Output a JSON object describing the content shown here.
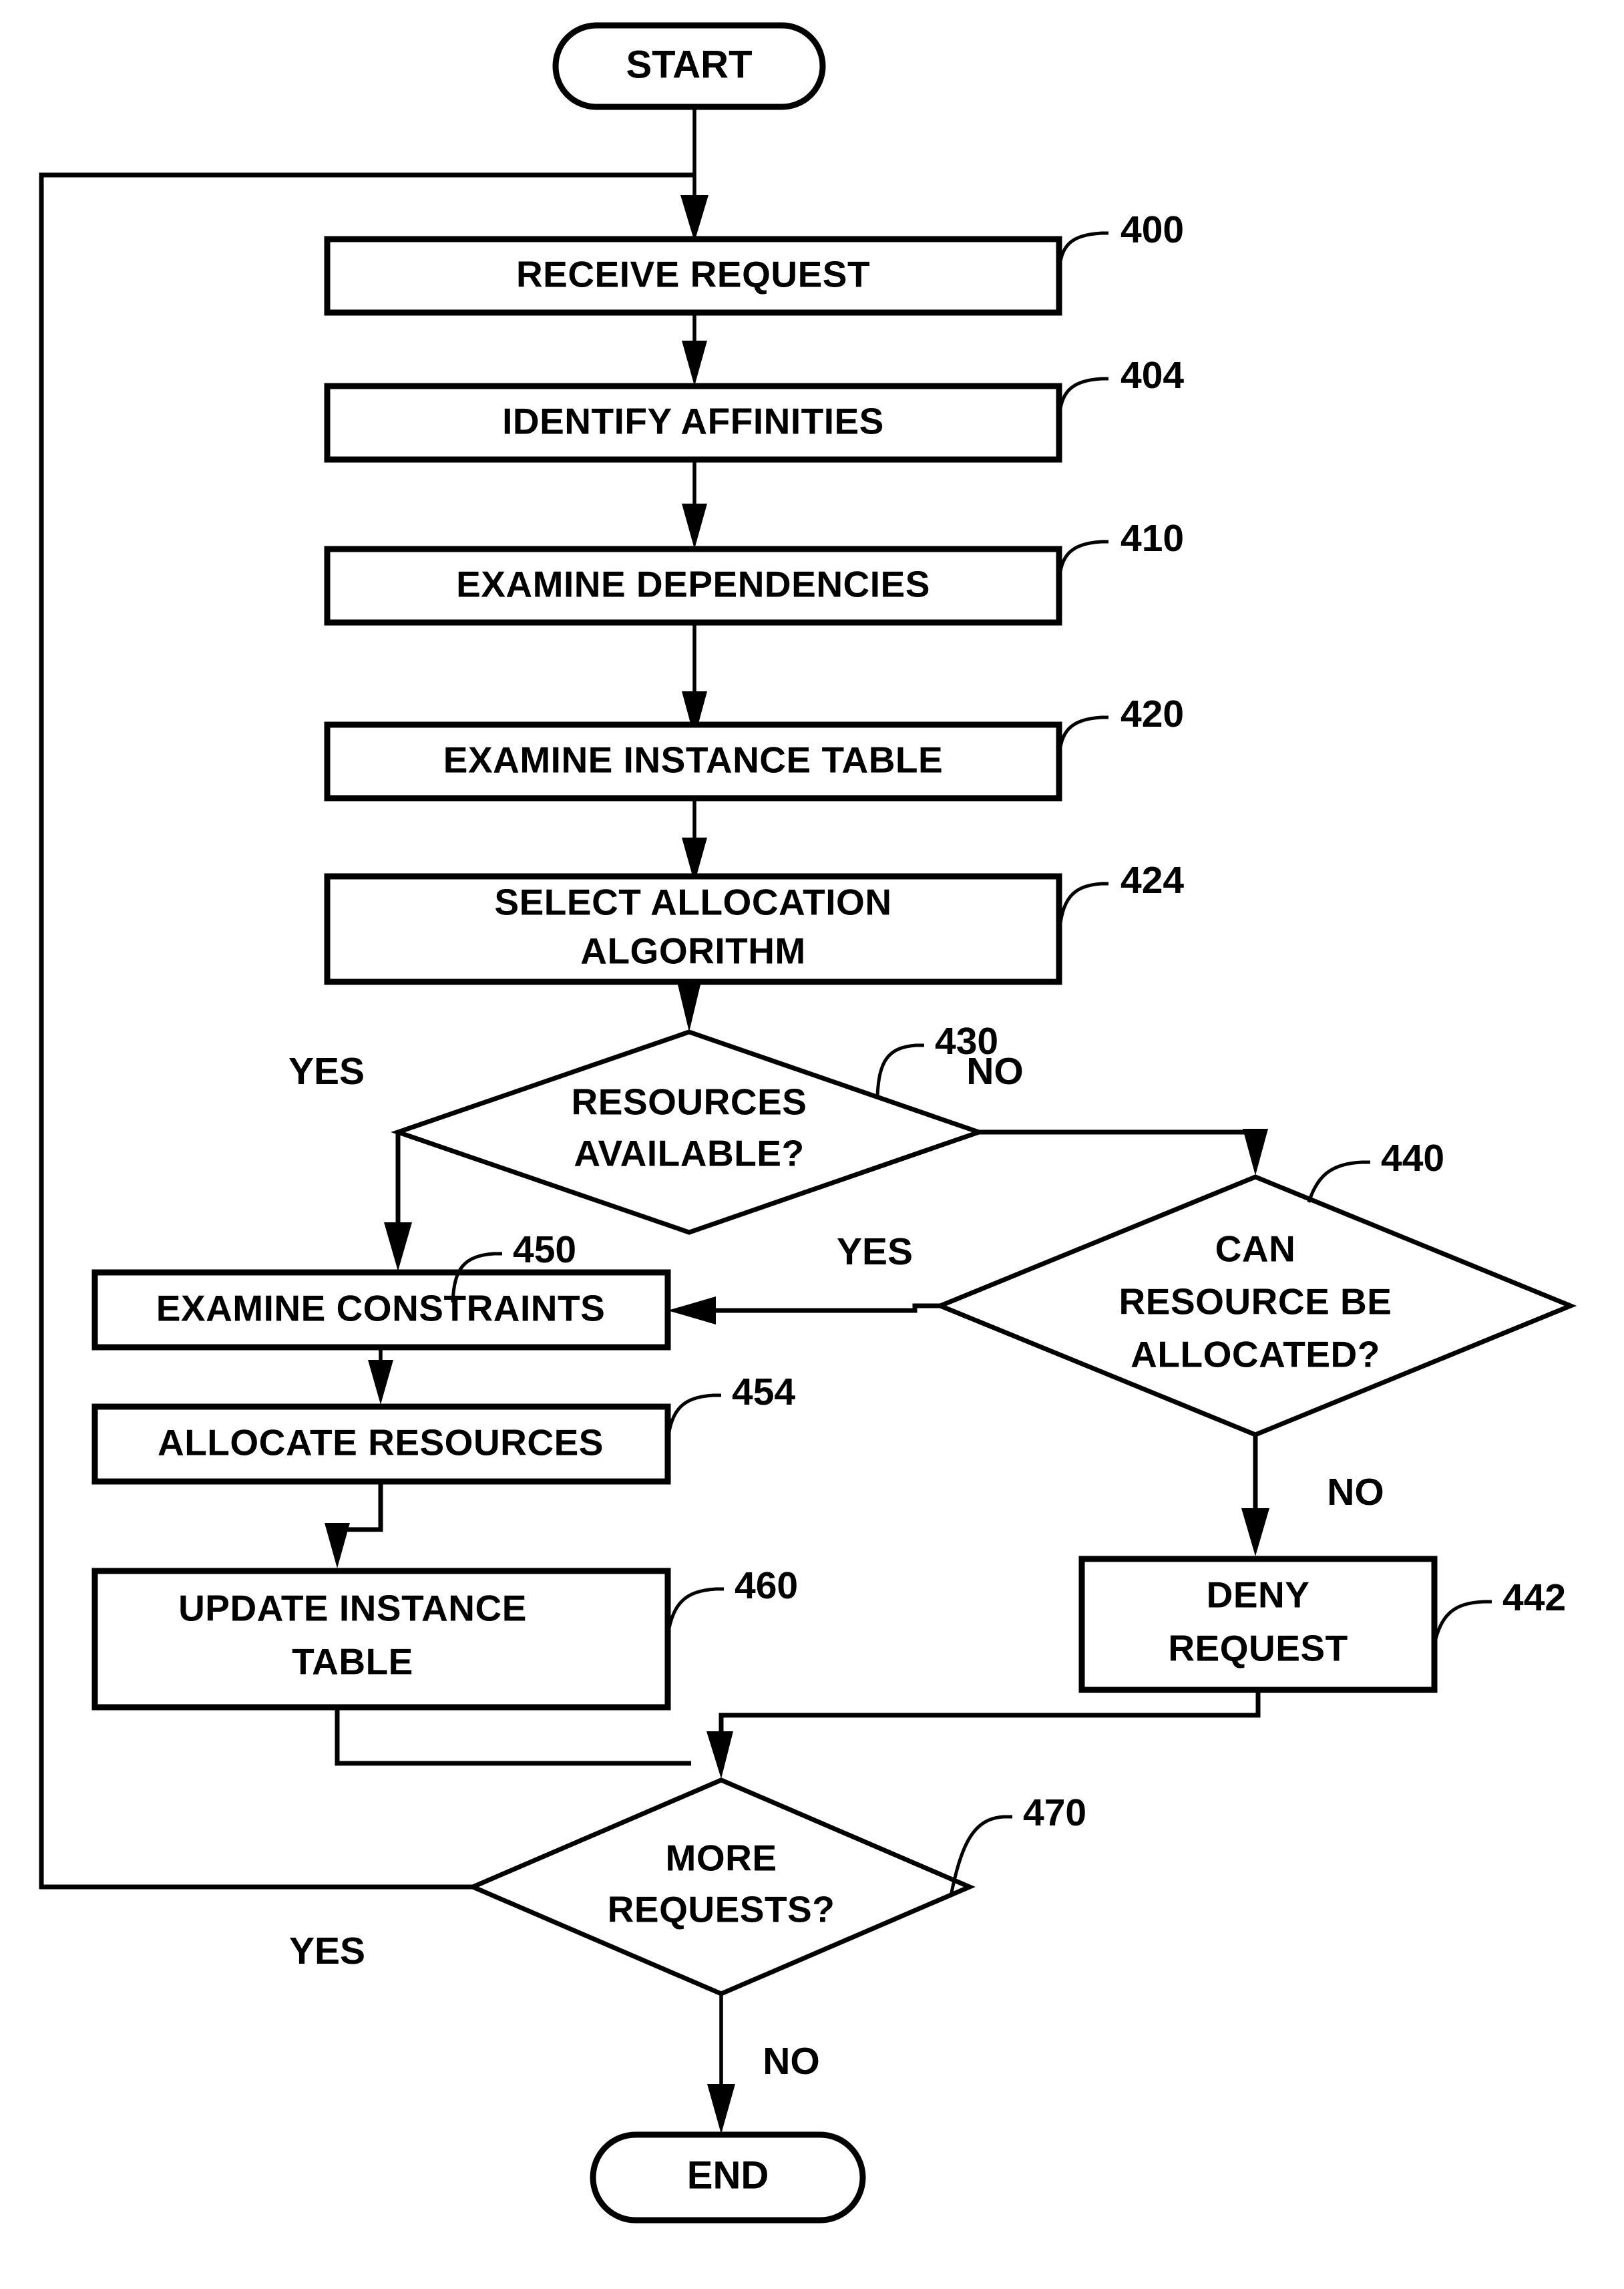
{
  "diagram": {
    "type": "flowchart",
    "title": "Resource Allocation Request Handling Flowchart",
    "terminals": {
      "start": "START",
      "end": "END"
    },
    "nodes": [
      {
        "id": "400",
        "label": "RECEIVE REQUEST",
        "shape": "process",
        "ref": "400"
      },
      {
        "id": "404",
        "label": "IDENTIFY AFFINITIES",
        "shape": "process",
        "ref": "404"
      },
      {
        "id": "410",
        "label": "EXAMINE DEPENDENCIES",
        "shape": "process",
        "ref": "410"
      },
      {
        "id": "420",
        "label": "EXAMINE INSTANCE TABLE",
        "shape": "process",
        "ref": "420"
      },
      {
        "id": "424",
        "label_line1": "SELECT ALLOCATION",
        "label_line2": "ALGORITHM",
        "shape": "process",
        "ref": "424"
      },
      {
        "id": "430",
        "label_line1": "RESOURCES",
        "label_line2": "AVAILABLE?",
        "shape": "decision",
        "ref": "430"
      },
      {
        "id": "440",
        "label_line1": "CAN",
        "label_line2": "RESOURCE BE",
        "label_line3": "ALLOCATED?",
        "shape": "decision",
        "ref": "440"
      },
      {
        "id": "442",
        "label_line1": "DENY",
        "label_line2": "REQUEST",
        "shape": "process",
        "ref": "442"
      },
      {
        "id": "450",
        "label": "EXAMINE CONSTRAINTS",
        "shape": "process",
        "ref": "450"
      },
      {
        "id": "454",
        "label": "ALLOCATE RESOURCES",
        "shape": "process",
        "ref": "454"
      },
      {
        "id": "460",
        "label_line1": "UPDATE INSTANCE",
        "label_line2": "TABLE",
        "shape": "process",
        "ref": "460"
      },
      {
        "id": "470",
        "label_line1": "MORE",
        "label_line2": "REQUESTS?",
        "shape": "decision",
        "ref": "470"
      }
    ],
    "branch_labels": {
      "d430_yes": "YES",
      "d430_no": "NO",
      "d440_yes": "YES",
      "d440_no": "NO",
      "d470_yes": "YES",
      "d470_no": "NO"
    },
    "reference_numerals": {
      "n400": "400",
      "n404": "404",
      "n410": "410",
      "n420": "420",
      "n424": "424",
      "n430": "430",
      "n440": "440",
      "n442": "442",
      "n450": "450",
      "n454": "454",
      "n460": "460",
      "n470": "470"
    },
    "colors": {
      "line": "#000000",
      "fill": "#ffffff",
      "text": "#000000"
    }
  }
}
